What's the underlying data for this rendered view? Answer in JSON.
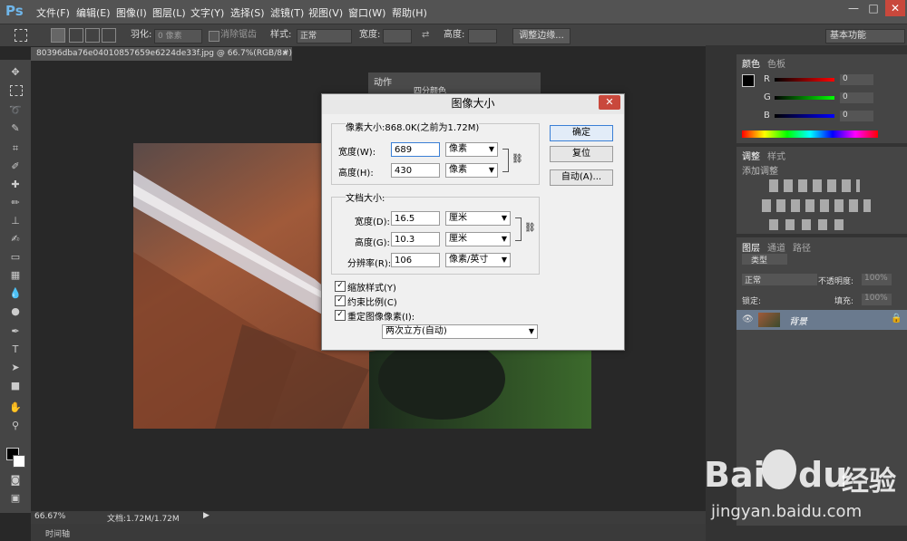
{
  "app": {
    "logo": "Ps"
  },
  "menu": [
    "文件(F)",
    "编辑(E)",
    "图像(I)",
    "图层(L)",
    "文字(Y)",
    "选择(S)",
    "滤镜(T)",
    "视图(V)",
    "窗口(W)",
    "帮助(H)"
  ],
  "window_controls": {
    "minimize": "—",
    "restore": "□",
    "close": "✕"
  },
  "options_bar": {
    "feather_label": "羽化:",
    "feather_value": "0 像素",
    "antialias_label": "消除锯齿",
    "style_label": "样式:",
    "style_value": "正常",
    "width_label": "宽度:",
    "height_label": "高度:",
    "refine_edge": "调整边缘...",
    "workspace": "基本功能"
  },
  "document": {
    "tab_title": "80396dba76e04010857659e6224de33f.jpg @ 66.7%(RGB/8#)",
    "close": "×"
  },
  "actions_panel": {
    "tab": "动作",
    "item": "四分颜色"
  },
  "status": {
    "zoom": "66.67%",
    "doc_info": "文档:1.72M/1.72M",
    "timeline": "时间轴"
  },
  "color_panel": {
    "tabs": [
      "颜色",
      "色板"
    ],
    "channels": [
      {
        "label": "R",
        "value": "0"
      },
      {
        "label": "G",
        "value": "0"
      },
      {
        "label": "B",
        "value": "0"
      }
    ]
  },
  "adjust_panel": {
    "tabs": [
      "调整",
      "样式"
    ],
    "add_label": "添加调整"
  },
  "layers_panel": {
    "tabs": [
      "图层",
      "通道",
      "路径"
    ],
    "filter": "类型",
    "blend_mode": "正常",
    "opacity_label": "不透明度:",
    "opacity_value": "100%",
    "lock_label": "锁定:",
    "fill_label": "填充:",
    "fill_value": "100%",
    "layer_name": "背景"
  },
  "dialog": {
    "title": "图像大小",
    "close": "✕",
    "pixel_dims": "像素大小:868.0K(之前为1.72M)",
    "width_label": "宽度(W):",
    "width_value": "689",
    "width_unit": "像素",
    "height_label": "高度(H):",
    "height_value": "430",
    "height_unit": "像素",
    "doc_size": "文档大小:",
    "doc_width_label": "宽度(D):",
    "doc_width_value": "16.5",
    "doc_width_unit": "厘米",
    "doc_height_label": "高度(G):",
    "doc_height_value": "10.3",
    "doc_height_unit": "厘米",
    "resolution_label": "分辨率(R):",
    "resolution_value": "106",
    "resolution_unit": "像素/英寸",
    "scale_styles": "缩放样式(Y)",
    "constrain": "约束比例(C)",
    "resample": "重定图像像素(I):",
    "resample_method": "两次立方(自动)",
    "ok": "确定",
    "reset": "复位",
    "auto": "自动(A)..."
  },
  "watermark": {
    "brand": "Bai",
    "brand2": "du",
    "cn": "经验",
    "url": "jingyan.baidu.com"
  },
  "colors": {
    "accent": "#6fb6ea",
    "arrow": "#e02020",
    "close": "#c9483c"
  }
}
